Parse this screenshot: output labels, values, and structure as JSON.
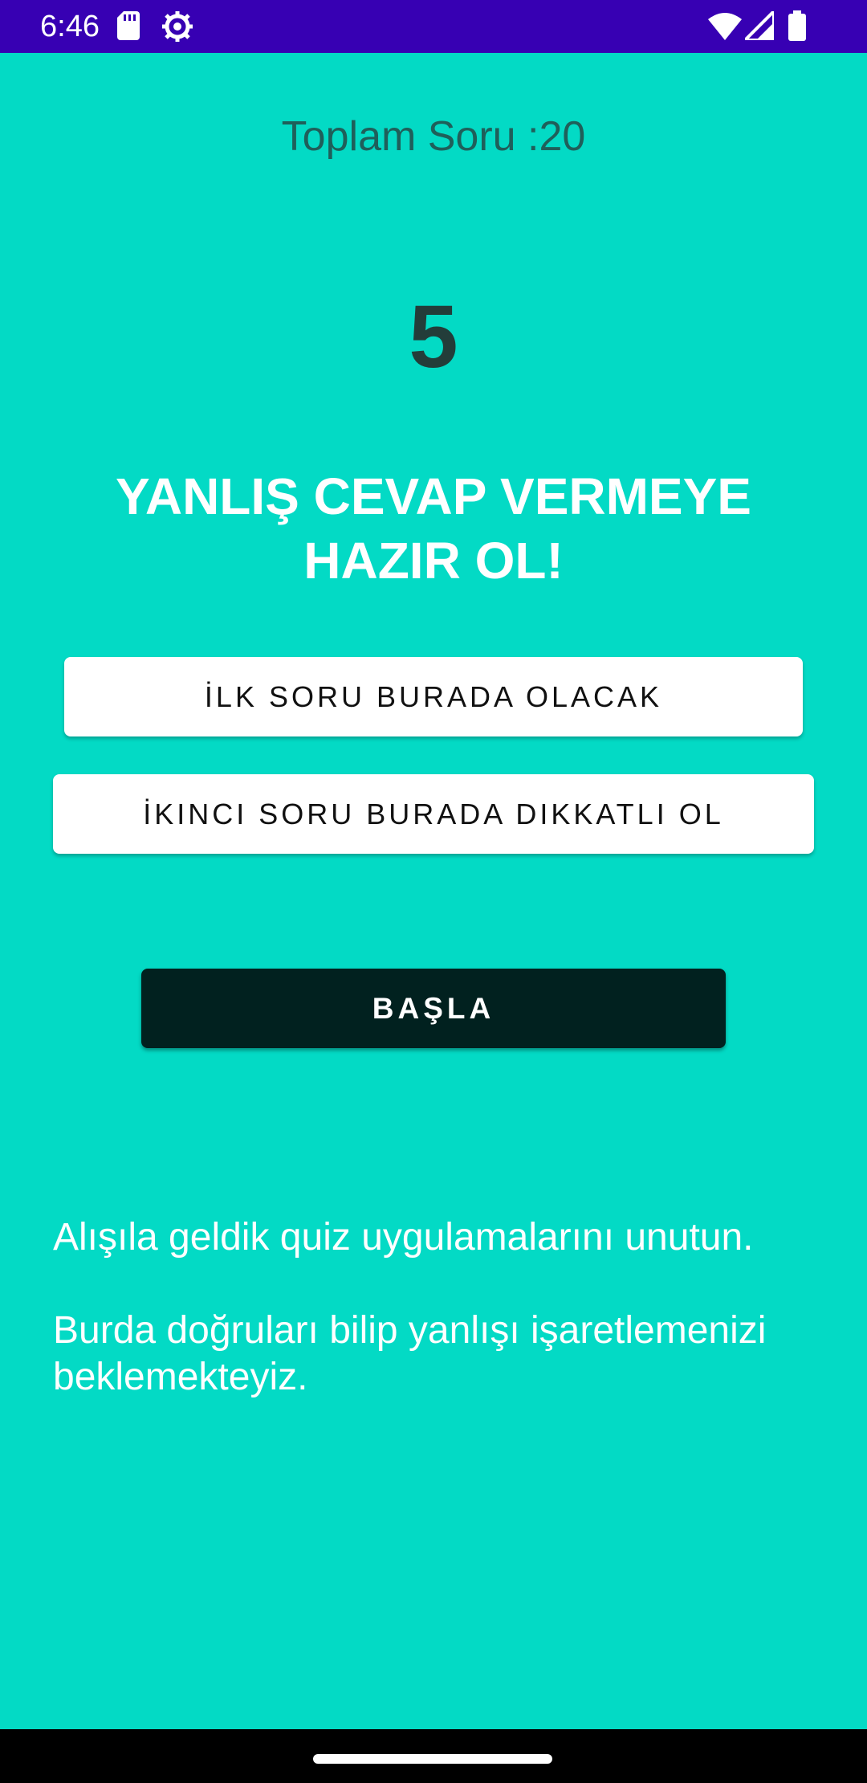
{
  "status_bar": {
    "time": "6:46",
    "icons": [
      "sd-card-icon",
      "settings-gear-icon",
      "wifi-icon",
      "signal-icon",
      "battery-icon"
    ]
  },
  "quiz": {
    "total_label": "Toplam Soru :20",
    "countdown": "5",
    "headline": "YANLIŞ CEVAP VERMEYE HAZIR OL!",
    "question_1": "İLK SORU BURADA OLACAK",
    "question_2": "İKINCI SORU BURADA DIKKATLI OL",
    "start_label": "BAŞLA",
    "description_1": "Alışıla geldik quiz uygulamalarını unutun.",
    "description_2": "Burda doğruları bilip yanlışı işaretlemenizi beklemekteyiz."
  },
  "colors": {
    "background": "#03DAC5",
    "status_bar": "#3700B3",
    "start_button": "#01211F",
    "question_button": "#FFFFFF"
  }
}
